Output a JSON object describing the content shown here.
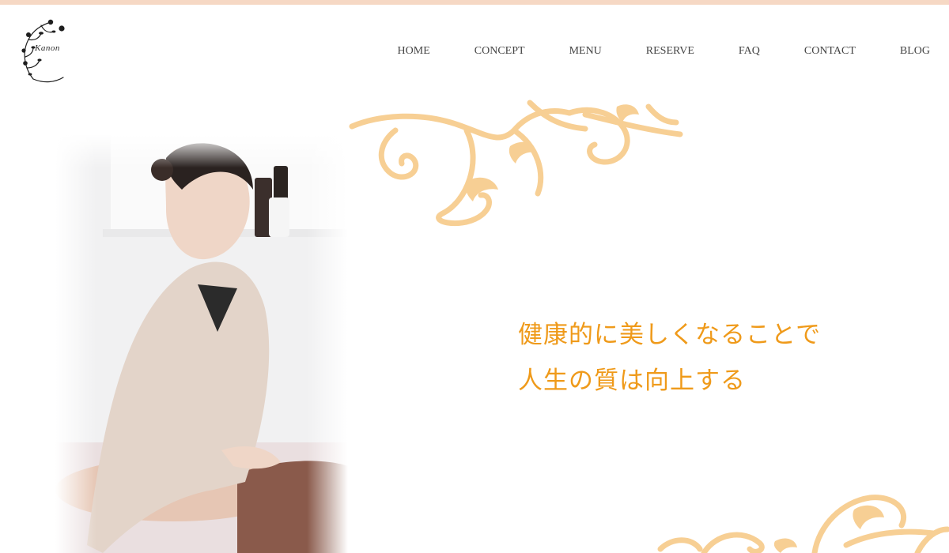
{
  "brand": {
    "logo_text": "Kanon"
  },
  "nav": {
    "items": [
      {
        "label": "HOME"
      },
      {
        "label": "CONCEPT"
      },
      {
        "label": "MENU"
      },
      {
        "label": "RESERVE"
      },
      {
        "label": "FAQ"
      },
      {
        "label": "CONTACT"
      },
      {
        "label": "BLOG"
      }
    ]
  },
  "hero": {
    "headline_line1": "健康的に美しくなることで",
    "headline_line2": "人生の質は向上する"
  },
  "colors": {
    "top_bar": "#f6d8c4",
    "headline": "#ef9a1a",
    "ornament": "#f7cf94"
  },
  "icons": {
    "logo": "floral-vine-logo",
    "ornament": "baroque-scroll-ornament"
  }
}
